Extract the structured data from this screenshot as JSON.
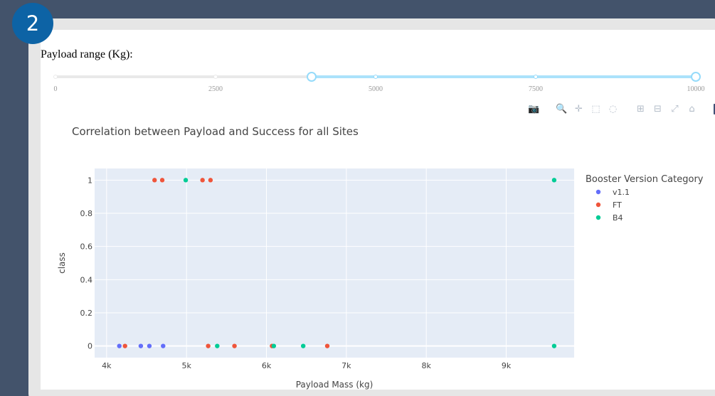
{
  "step_badge": "2",
  "range_slider": {
    "label": "Payload range (Kg):",
    "min": 0,
    "max": 10000,
    "selected": [
      4000,
      10000
    ],
    "marks": [
      "0",
      "2500",
      "5000",
      "7500",
      "10000"
    ]
  },
  "modebar": {
    "buttons": [
      {
        "name": "camera-icon",
        "glyph": "📷"
      },
      {
        "name": "zoom-icon",
        "glyph": "🔍"
      },
      {
        "name": "pan-icon",
        "glyph": "✛"
      },
      {
        "name": "box-select-icon",
        "glyph": "⬚"
      },
      {
        "name": "lasso-select-icon",
        "glyph": "◌"
      },
      {
        "name": "zoom-in-icon",
        "glyph": "⊞"
      },
      {
        "name": "zoom-out-icon",
        "glyph": "⊟"
      },
      {
        "name": "autoscale-icon",
        "glyph": "⤢"
      },
      {
        "name": "reset-axes-icon",
        "glyph": "⌂"
      }
    ],
    "logo": "plotly-logo-icon"
  },
  "chart_data": {
    "type": "scatter",
    "title": "Correlation between Payload and Success for all Sites",
    "xlabel": "Payload Mass (kg)",
    "ylabel": "class",
    "xlim": [
      3850,
      9850
    ],
    "ylim": [
      -0.07,
      1.07
    ],
    "x_ticks": [
      {
        "value": 4000,
        "label": "4k"
      },
      {
        "value": 5000,
        "label": "5k"
      },
      {
        "value": 6000,
        "label": "6k"
      },
      {
        "value": 7000,
        "label": "7k"
      },
      {
        "value": 8000,
        "label": "8k"
      },
      {
        "value": 9000,
        "label": "9k"
      }
    ],
    "y_ticks": [
      {
        "value": 0,
        "label": "0"
      },
      {
        "value": 0.2,
        "label": "0.2"
      },
      {
        "value": 0.4,
        "label": "0.4"
      },
      {
        "value": 0.6,
        "label": "0.6"
      },
      {
        "value": 0.8,
        "label": "0.8"
      },
      {
        "value": 1,
        "label": "1"
      }
    ],
    "grid": true,
    "plot_background": "#e5ecf6",
    "legend": {
      "title": "Booster Version Category",
      "placement": "right"
    },
    "series": [
      {
        "name": "v1.1",
        "color": "#636efa",
        "points": [
          [
            4159,
            0
          ],
          [
            4428,
            0
          ],
          [
            4535,
            0
          ],
          [
            4707,
            0
          ]
        ]
      },
      {
        "name": "FT",
        "color": "#ef553b",
        "points": [
          [
            4230,
            0
          ],
          [
            4600,
            1
          ],
          [
            4696,
            1
          ],
          [
            5200,
            1
          ],
          [
            5300,
            1
          ],
          [
            5271,
            0
          ],
          [
            5600,
            0
          ],
          [
            6070,
            0
          ],
          [
            6761,
            0
          ]
        ]
      },
      {
        "name": "B4",
        "color": "#00cc96",
        "points": [
          [
            4990,
            1
          ],
          [
            5384,
            0
          ],
          [
            6092,
            0
          ],
          [
            6460,
            0
          ],
          [
            9600,
            1
          ],
          [
            9600,
            0
          ]
        ]
      }
    ]
  }
}
